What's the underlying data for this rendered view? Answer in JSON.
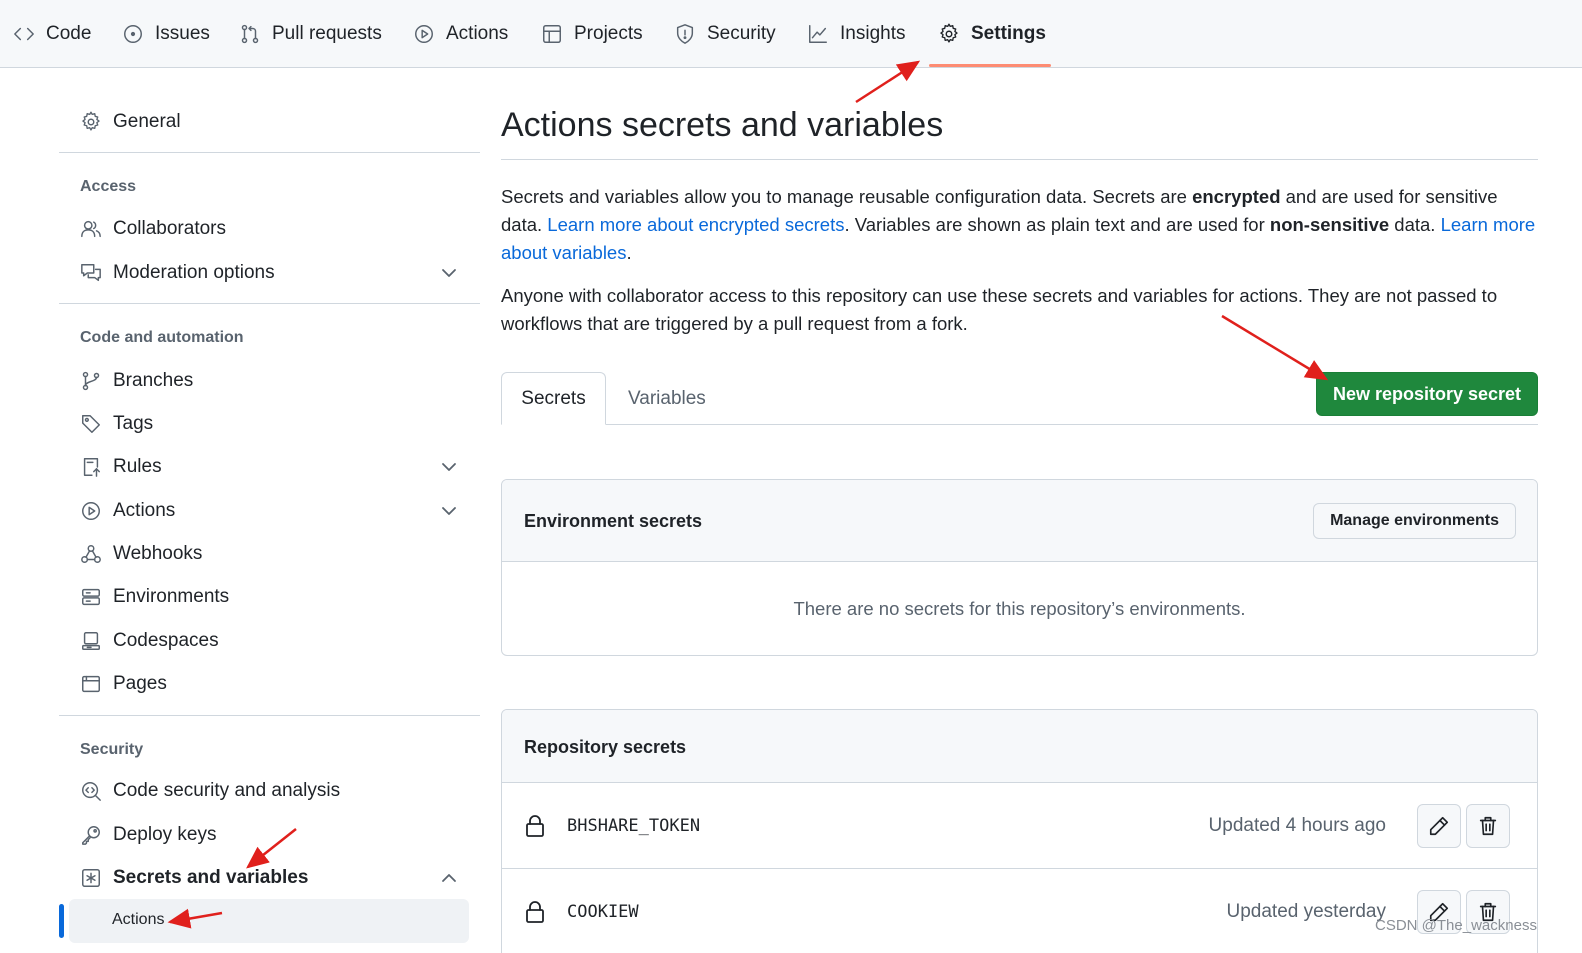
{
  "topnav": {
    "tabs": [
      {
        "label": "Code",
        "icon": "code-icon"
      },
      {
        "label": "Issues",
        "icon": "issue-opened-icon"
      },
      {
        "label": "Pull requests",
        "icon": "git-pull-request-icon"
      },
      {
        "label": "Actions",
        "icon": "play-icon"
      },
      {
        "label": "Projects",
        "icon": "table-icon"
      },
      {
        "label": "Security",
        "icon": "shield-icon"
      },
      {
        "label": "Insights",
        "icon": "graph-icon"
      },
      {
        "label": "Settings",
        "icon": "gear-icon"
      }
    ],
    "active_tab": "Settings",
    "accent_color": "#fd8c73"
  },
  "sidebar": {
    "general": "General",
    "access_heading": "Access",
    "collaborators": "Collaborators",
    "moderation": "Moderation options",
    "code_heading": "Code and automation",
    "branches": "Branches",
    "tags": "Tags",
    "rules": "Rules",
    "actions": "Actions",
    "webhooks": "Webhooks",
    "environments": "Environments",
    "codespaces": "Codespaces",
    "pages": "Pages",
    "security_heading": "Security",
    "code_security": "Code security and analysis",
    "deploy_keys": "Deploy keys",
    "secrets": "Secrets and variables",
    "secrets_sub_actions": "Actions"
  },
  "main": {
    "title": "Actions secrets and variables",
    "p1_a": "Secrets and variables allow you to manage reusable configuration data. Secrets are ",
    "p1_b": "encrypted",
    "p1_c": " and are used for sensitive data. ",
    "p1_link1": "Learn more about encrypted secrets",
    "p1_d": ". Variables are shown as plain text and are used for ",
    "p1_e": "non-sensitive",
    "p1_f": " data. ",
    "p1_link2": "Learn more about variables",
    "p1_g": ".",
    "p2": "Anyone with collaborator access to this repository can use these secrets and variables for actions. They are not passed to workflows that are triggered by a pull request from a fork.",
    "tab_secrets": "Secrets",
    "tab_variables": "Variables",
    "new_secret_button": "New repository secret",
    "env_title": "Environment secrets",
    "manage_env_button": "Manage environments",
    "env_empty": "There are no secrets for this repository’s environments.",
    "repo_title": "Repository secrets",
    "secrets": [
      {
        "name": "BHSHARE_TOKEN",
        "updated": "Updated 4 hours ago"
      },
      {
        "name": "COOKIEW",
        "updated": "Updated yesterday"
      }
    ],
    "primary_color": "#1f883d",
    "link_color": "#0969da"
  },
  "watermark": "CSDN @The_wackness",
  "annotation_color": "#e0201c"
}
